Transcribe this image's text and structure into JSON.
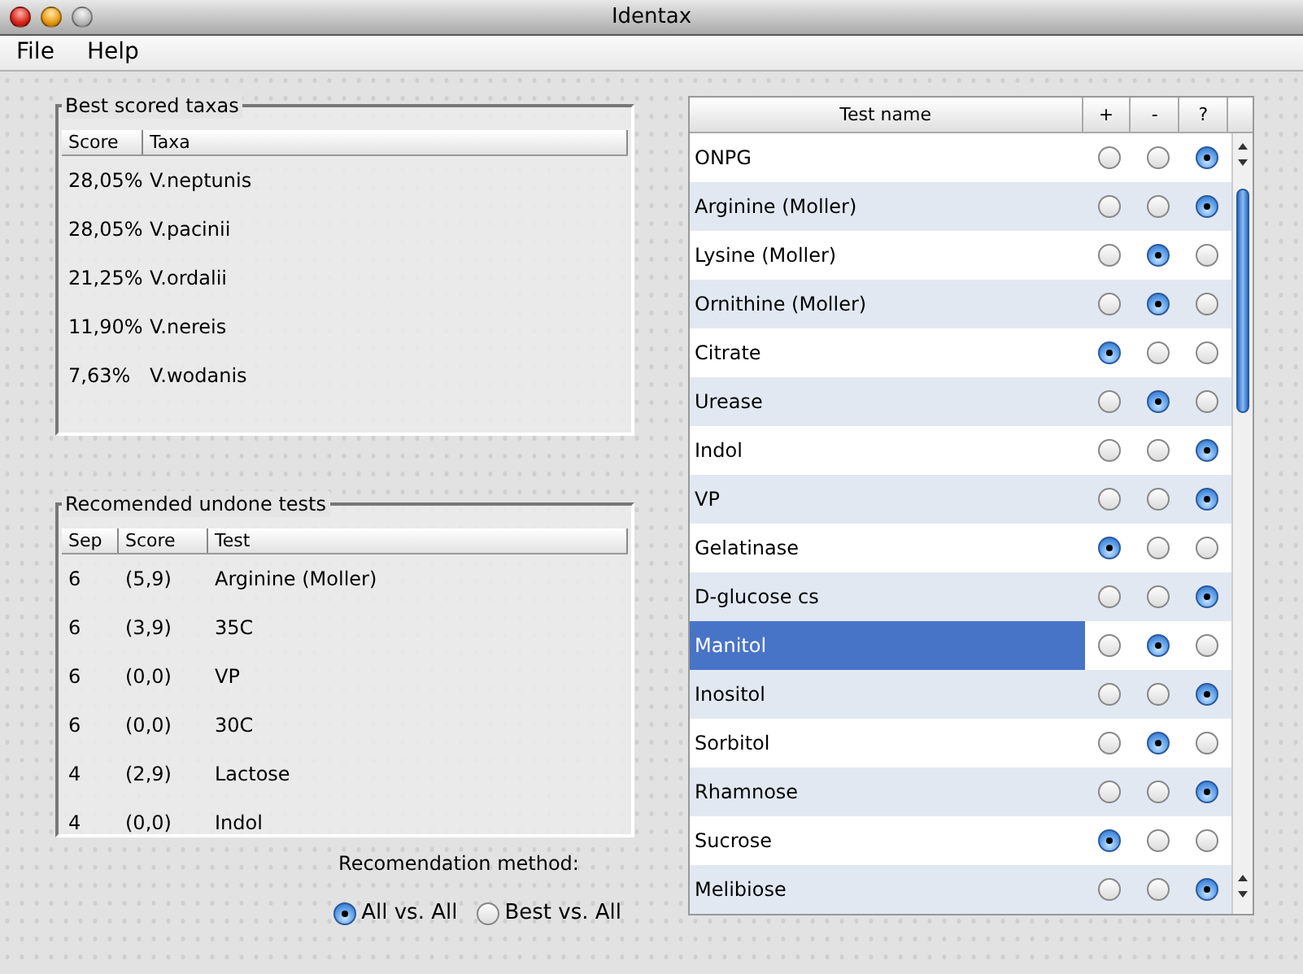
{
  "window": {
    "title": "Identax"
  },
  "menu": [
    "File",
    "Help"
  ],
  "best_taxa": {
    "title": "Best scored taxas",
    "columns": [
      "Score",
      "Taxa"
    ],
    "rows": [
      [
        "28,05%",
        "V.neptunis"
      ],
      [
        "28,05%",
        "V.pacinii"
      ],
      [
        "21,25%",
        "V.ordalii"
      ],
      [
        "11,90%",
        "V.nereis"
      ],
      [
        "7,63%",
        "V.wodanis"
      ]
    ]
  },
  "recommended": {
    "title": "Recomended undone tests",
    "columns": [
      "Sep",
      "Score",
      "Test"
    ],
    "rows": [
      [
        "6",
        "(5,9)",
        "Arginine (Moller)"
      ],
      [
        "6",
        "(3,9)",
        "35C"
      ],
      [
        "6",
        "(0,0)",
        "VP"
      ],
      [
        "6",
        "(0,0)",
        "30C"
      ],
      [
        "4",
        "(2,9)",
        "Lactose"
      ],
      [
        "4",
        "(0,0)",
        "Indol"
      ]
    ]
  },
  "method": {
    "label": "Recomendation method:",
    "options": [
      {
        "label": "All vs. All",
        "selected": true
      },
      {
        "label": "Best vs. All",
        "selected": false
      }
    ]
  },
  "tests": {
    "columns": [
      "Test name",
      "+",
      "-",
      "?"
    ],
    "rows": [
      {
        "name": "ONPG",
        "selected": false,
        "choices": [
          {
            "selected": false
          },
          {
            "selected": false
          },
          {
            "selected": true
          }
        ]
      },
      {
        "name": "Arginine (Moller)",
        "selected": false,
        "choices": [
          {
            "selected": false
          },
          {
            "selected": false
          },
          {
            "selected": true
          }
        ]
      },
      {
        "name": "Lysine (Moller)",
        "selected": false,
        "choices": [
          {
            "selected": false
          },
          {
            "selected": true
          },
          {
            "selected": false
          }
        ]
      },
      {
        "name": "Ornithine (Moller)",
        "selected": false,
        "choices": [
          {
            "selected": false
          },
          {
            "selected": true
          },
          {
            "selected": false
          }
        ]
      },
      {
        "name": "Citrate",
        "selected": false,
        "choices": [
          {
            "selected": true
          },
          {
            "selected": false
          },
          {
            "selected": false
          }
        ]
      },
      {
        "name": "Urease",
        "selected": false,
        "choices": [
          {
            "selected": false
          },
          {
            "selected": true
          },
          {
            "selected": false
          }
        ]
      },
      {
        "name": "Indol",
        "selected": false,
        "choices": [
          {
            "selected": false
          },
          {
            "selected": false
          },
          {
            "selected": true
          }
        ]
      },
      {
        "name": "VP",
        "selected": false,
        "choices": [
          {
            "selected": false
          },
          {
            "selected": false
          },
          {
            "selected": true
          }
        ]
      },
      {
        "name": "Gelatinase",
        "selected": false,
        "choices": [
          {
            "selected": true
          },
          {
            "selected": false
          },
          {
            "selected": false
          }
        ]
      },
      {
        "name": "D-glucose cs",
        "selected": false,
        "choices": [
          {
            "selected": false
          },
          {
            "selected": false
          },
          {
            "selected": true
          }
        ]
      },
      {
        "name": "Manitol",
        "selected": true,
        "choices": [
          {
            "selected": false
          },
          {
            "selected": true
          },
          {
            "selected": false
          }
        ]
      },
      {
        "name": "Inositol",
        "selected": false,
        "choices": [
          {
            "selected": false
          },
          {
            "selected": false
          },
          {
            "selected": true
          }
        ]
      },
      {
        "name": "Sorbitol",
        "selected": false,
        "choices": [
          {
            "selected": false
          },
          {
            "selected": true
          },
          {
            "selected": false
          }
        ]
      },
      {
        "name": "Rhamnose",
        "selected": false,
        "choices": [
          {
            "selected": false
          },
          {
            "selected": false
          },
          {
            "selected": true
          }
        ]
      },
      {
        "name": "Sucrose",
        "selected": false,
        "choices": [
          {
            "selected": true
          },
          {
            "selected": false
          },
          {
            "selected": false
          }
        ]
      },
      {
        "name": "Melibiose",
        "selected": false,
        "choices": [
          {
            "selected": false
          },
          {
            "selected": false
          },
          {
            "selected": true
          }
        ]
      }
    ]
  }
}
